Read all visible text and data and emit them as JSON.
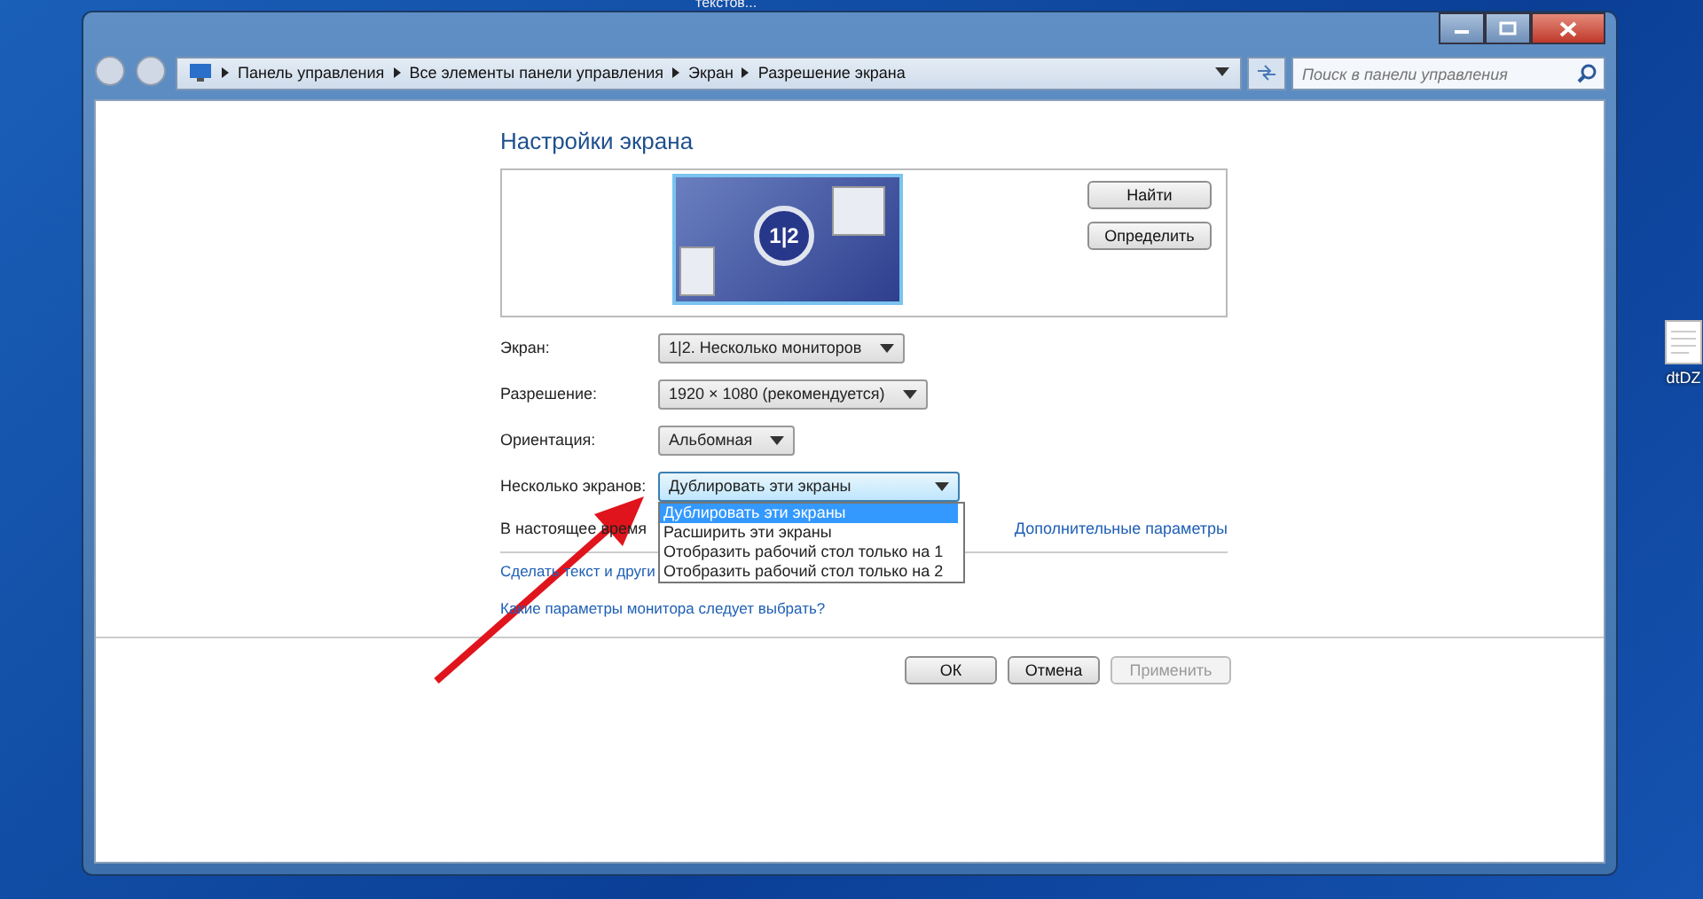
{
  "desktop": {
    "top_caption": "текстов...",
    "icon_label": "dtDZ"
  },
  "address_bar": {
    "crumbs": [
      "Панель управления",
      "Все элементы панели управления",
      "Экран",
      "Разрешение экрана"
    ]
  },
  "search": {
    "placeholder": "Поиск в панели управления"
  },
  "heading": "Настройки экрана",
  "preview": {
    "badge": "1|2",
    "buttons": [
      {
        "label": "Найти"
      },
      {
        "label": "Определить"
      }
    ]
  },
  "fields": [
    {
      "label": "Экран:",
      "value": "1|2. Несколько мониторов"
    },
    {
      "label": "Разрешение:",
      "value": "1920 × 1080 (рекомендуется)"
    },
    {
      "label": "Ориентация:",
      "value": "Альбомная"
    },
    {
      "label": "Несколько экранов:",
      "value": "Дублировать эти экраны",
      "expanded": true
    }
  ],
  "dropdown_options": [
    {
      "label": "Дублировать эти экраны",
      "selected": true
    },
    {
      "label": "Расширить эти экраны",
      "selected": false
    },
    {
      "label": "Отобразить рабочий стол только на 1",
      "selected": false
    },
    {
      "label": "Отобразить рабочий стол только на 2",
      "selected": false
    }
  ],
  "status_text": "В настоящее время",
  "advanced_link": "Дополнительные параметры",
  "links": [
    "Сделать текст и други",
    "Какие параметры монитора следует выбрать?"
  ],
  "buttons": [
    {
      "label": "ОК",
      "disabled": false
    },
    {
      "label": "Отмена",
      "disabled": false
    },
    {
      "label": "Применить",
      "disabled": true
    }
  ]
}
